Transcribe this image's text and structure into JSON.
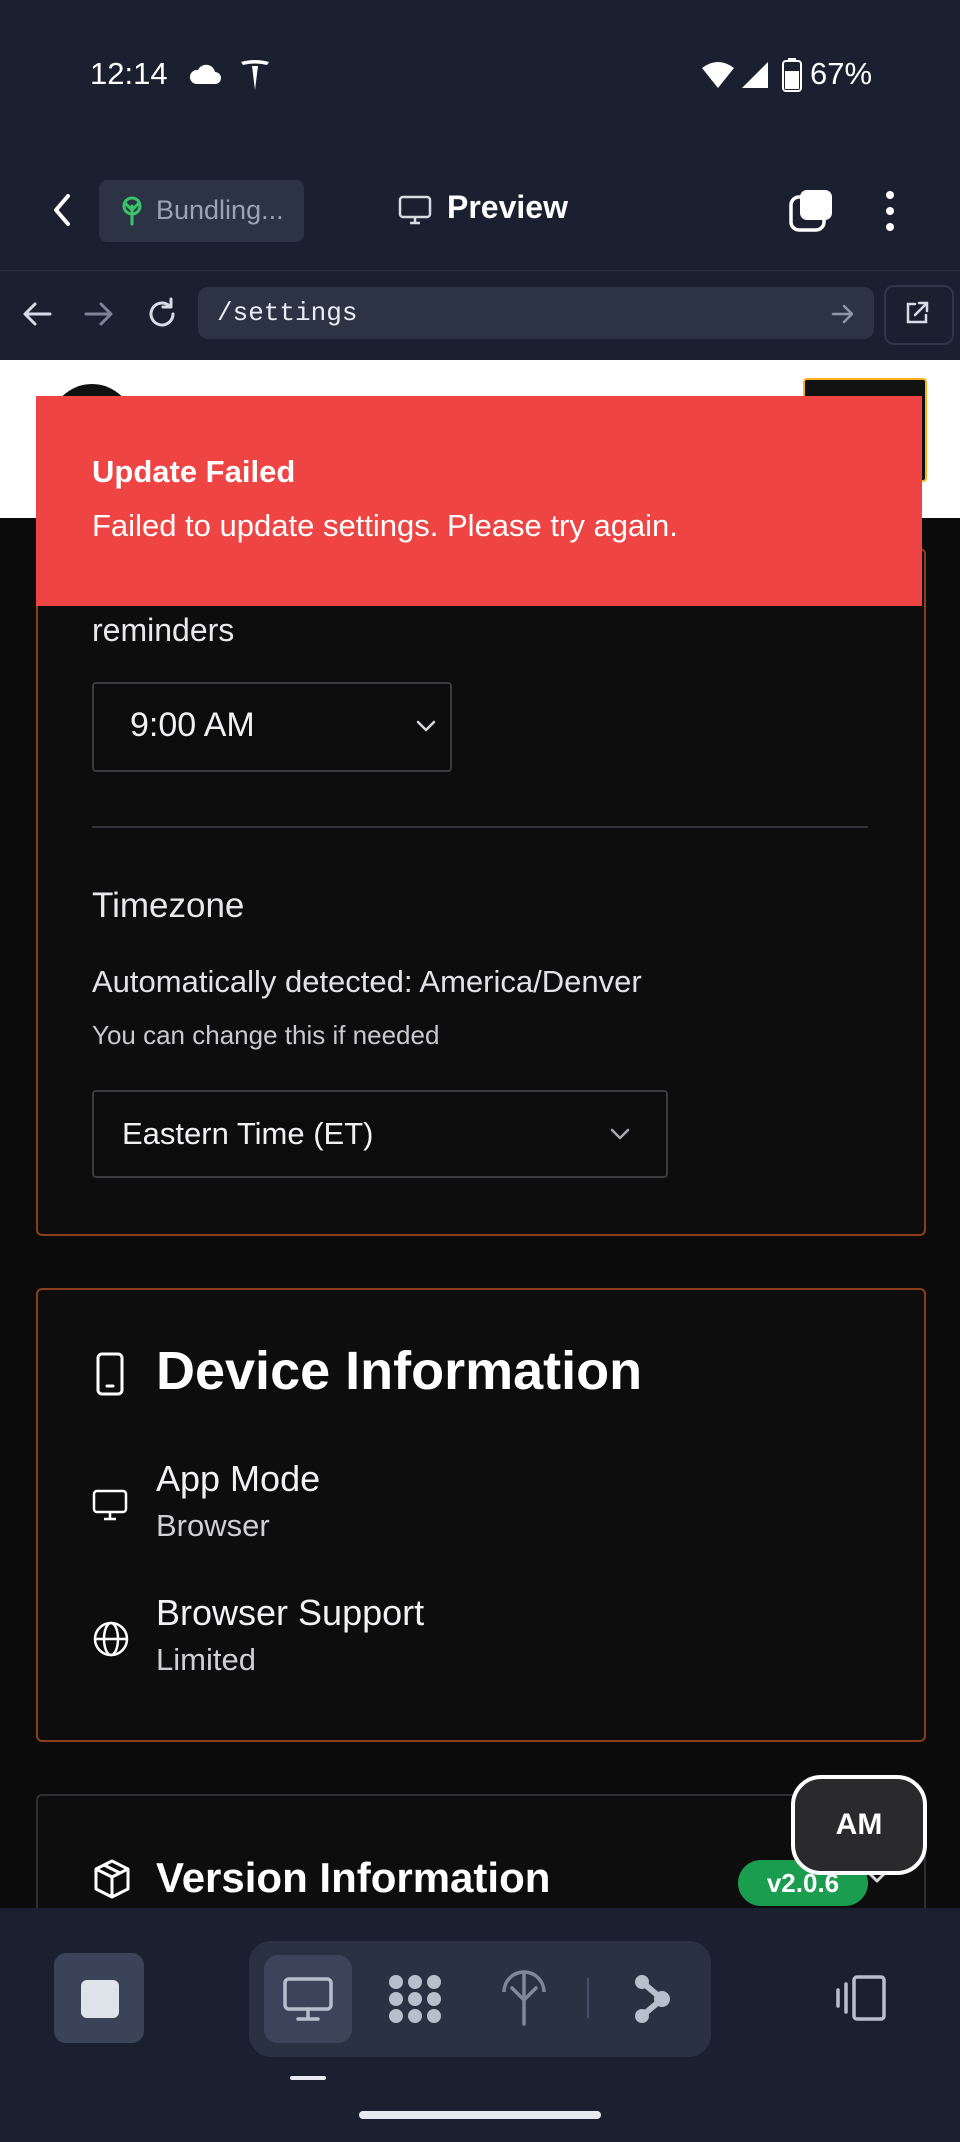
{
  "status_bar": {
    "time": "12:14",
    "battery": "67%",
    "icons": [
      "cloud-icon",
      "tesla-icon",
      "wifi-icon",
      "signal-icon",
      "battery-icon"
    ]
  },
  "app_bar": {
    "bundling_label": "Bundling...",
    "preview_label": "Preview"
  },
  "browser_bar": {
    "url": "/settings"
  },
  "toast": {
    "title": "Update Failed",
    "message": "Failed to update settings. Please try again."
  },
  "reminders": {
    "label": "reminders",
    "time_value": "9:00 AM"
  },
  "timezone": {
    "title": "Timezone",
    "detected": "Automatically detected: America/Denver",
    "hint": "You can change this if needed",
    "selected": "Eastern Time (ET)"
  },
  "device_info": {
    "title": "Device Information",
    "items": [
      {
        "label": "App Mode",
        "value": "Browser"
      },
      {
        "label": "Browser Support",
        "value": "Limited"
      }
    ]
  },
  "version_info": {
    "title": "Version Information",
    "badge": "v2.0.6"
  },
  "fab": {
    "label": "AM"
  },
  "colors": {
    "toast_bg": "#ef4444",
    "card_border": "#8a3f1a",
    "badge_green": "#1a9d4f",
    "chrome_bg": "#1b2030"
  }
}
